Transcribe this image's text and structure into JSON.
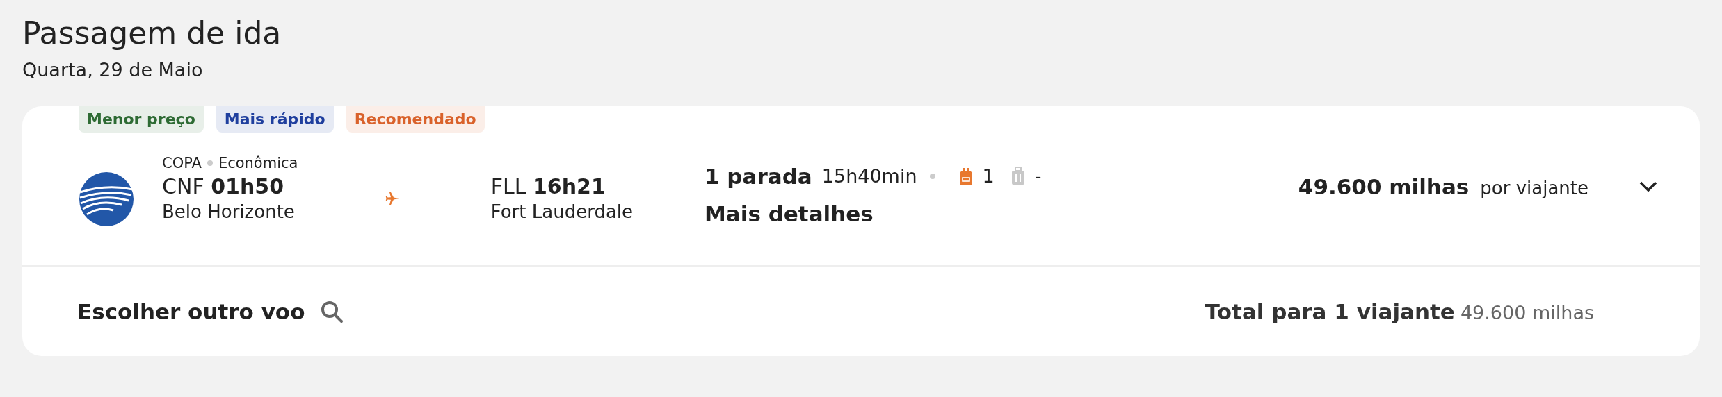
{
  "page": {
    "title": "Passagem de ida",
    "date": "Quarta, 29 de Maio"
  },
  "flight": {
    "tags": [
      {
        "label": "Menor preço",
        "color": "#2e6b34"
      },
      {
        "label": "Mais rápido",
        "color": "#1f3f9e"
      },
      {
        "label": "Recomendado",
        "color": "#d9622b"
      }
    ],
    "airline": "COPA",
    "cabin": "Econômica",
    "departure": {
      "code": "CNF",
      "time": "01h50",
      "city": "Belo Horizonte"
    },
    "arrival": {
      "code": "FLL",
      "time": "16h21",
      "city": "Fort Lauderdale"
    },
    "stops": "1 parada",
    "duration": "15h40min",
    "baggage": [
      {
        "kind": "backpack",
        "included": true,
        "count": "1"
      },
      {
        "kind": "suitcase",
        "included": false,
        "count": "-"
      }
    ],
    "details_link": "Mais detalhes",
    "price": "49.600 milhas",
    "price_note": "por viajante",
    "expanded": false
  },
  "footer": {
    "search_link": "Escolher outro voo",
    "total_label": "Total para 1 viajante",
    "total_value": "49.600 milhas"
  }
}
